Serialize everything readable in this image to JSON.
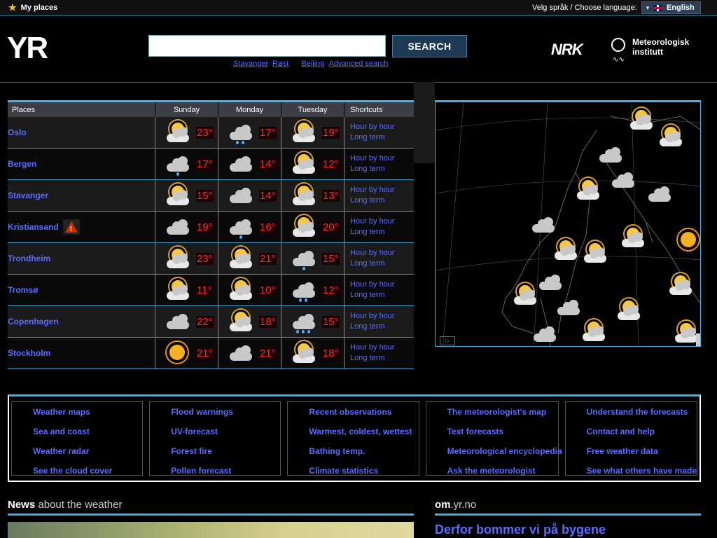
{
  "topbar": {
    "my_places": "My places",
    "language_label": "Velg språk / Choose language:",
    "language_value": "English"
  },
  "header": {
    "logo": "YR",
    "search_placeholder": "",
    "search_button": "SEARCH",
    "quick_links": [
      "Stavanger",
      "Røst",
      "Beijing",
      "Advanced search"
    ],
    "nrk": "NRK",
    "met_line1": "Meteorologisk",
    "met_line2": "institutt"
  },
  "forecast": {
    "columns": [
      "Places",
      "Sunday",
      "Monday",
      "Tuesday",
      "Shortcuts"
    ],
    "shortcut_hour": "Hour by hour",
    "shortcut_long": "Long term",
    "rows": [
      {
        "place": "Oslo",
        "warning": false,
        "days": [
          {
            "icon": "partly-cloudy",
            "temp": "23°"
          },
          {
            "icon": "cloud-rain",
            "temp": "17°"
          },
          {
            "icon": "partly-cloudy",
            "temp": "19°"
          }
        ]
      },
      {
        "place": "Bergen",
        "warning": false,
        "days": [
          {
            "icon": "cloud-drizzle",
            "temp": "17°"
          },
          {
            "icon": "cloudy",
            "temp": "14°"
          },
          {
            "icon": "partly-cloudy",
            "temp": "12°"
          }
        ]
      },
      {
        "place": "Stavanger",
        "warning": false,
        "days": [
          {
            "icon": "partly-cloudy",
            "temp": "15°"
          },
          {
            "icon": "cloudy",
            "temp": "14°"
          },
          {
            "icon": "partly-cloudy",
            "temp": "13°"
          }
        ]
      },
      {
        "place": "Kristiansand",
        "warning": true,
        "days": [
          {
            "icon": "cloudy",
            "temp": "19°"
          },
          {
            "icon": "cloud-drizzle",
            "temp": "16°"
          },
          {
            "icon": "partly-cloudy",
            "temp": "20°"
          }
        ]
      },
      {
        "place": "Trondheim",
        "warning": false,
        "days": [
          {
            "icon": "partly-cloudy",
            "temp": "23°"
          },
          {
            "icon": "partly-cloudy",
            "temp": "21°"
          },
          {
            "icon": "cloud-drizzle",
            "temp": "15°"
          }
        ]
      },
      {
        "place": "Tromsø",
        "warning": false,
        "days": [
          {
            "icon": "partly-cloudy",
            "temp": "11°"
          },
          {
            "icon": "partly-cloudy",
            "temp": "10°"
          },
          {
            "icon": "cloud-rain",
            "temp": "12°"
          }
        ]
      },
      {
        "place": "Copenhagen",
        "warning": false,
        "days": [
          {
            "icon": "cloudy",
            "temp": "22°"
          },
          {
            "icon": "partly-cloudy",
            "temp": "18°"
          },
          {
            "icon": "cloud-heavy-rain",
            "temp": "15°"
          }
        ]
      },
      {
        "place": "Stockholm",
        "warning": false,
        "days": [
          {
            "icon": "sun",
            "temp": "21°"
          },
          {
            "icon": "cloudy",
            "temp": "21°"
          },
          {
            "icon": "partly-cloudy",
            "temp": "18°"
          }
        ]
      }
    ]
  },
  "links": [
    [
      "Weather maps",
      "Sea and coast",
      "Weather radar",
      "See the cloud cover"
    ],
    [
      "Flood warnings",
      "UV-forecast",
      "Forest fire",
      "Pollen forecast"
    ],
    [
      "Recent observations",
      "Warmest, coldest, wettest",
      "Bathing temp.",
      "Climate statistics"
    ],
    [
      "The meteorologist's map",
      "Text forecasts",
      "Meteorological encyclopedia",
      "Ask the meteorologist"
    ],
    [
      "Understand the forecasts",
      "Contact and help",
      "Free weather data",
      "See what others have made"
    ]
  ],
  "news": {
    "title_bold": "News",
    "title_rest": " about the weather"
  },
  "om": {
    "title_bold": "om",
    "title_rest": ".yr.no",
    "headline": "Derfor bommer vi på bygene"
  },
  "colors": {
    "accent": "#3fb0e8",
    "link": "#5b6cff",
    "temp": "#ff2a2a"
  }
}
